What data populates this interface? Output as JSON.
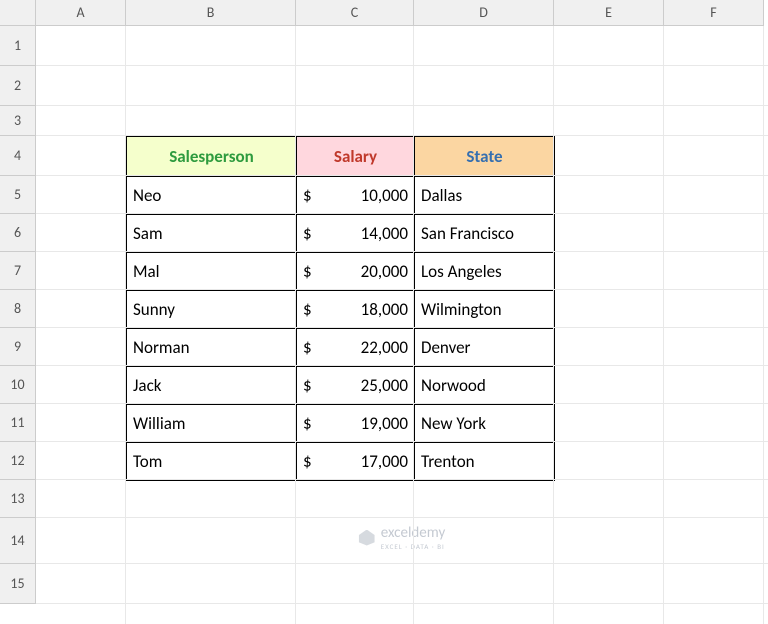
{
  "columns": [
    {
      "label": "A",
      "width": 90
    },
    {
      "label": "B",
      "width": 170
    },
    {
      "label": "C",
      "width": 118
    },
    {
      "label": "D",
      "width": 140
    },
    {
      "label": "E",
      "width": 110
    },
    {
      "label": "F",
      "width": 100
    }
  ],
  "rows": [
    {
      "label": "1",
      "height": 40
    },
    {
      "label": "2",
      "height": 40
    },
    {
      "label": "3",
      "height": 30
    },
    {
      "label": "4",
      "height": 40
    },
    {
      "label": "5",
      "height": 38
    },
    {
      "label": "6",
      "height": 38
    },
    {
      "label": "7",
      "height": 38
    },
    {
      "label": "8",
      "height": 38
    },
    {
      "label": "9",
      "height": 38
    },
    {
      "label": "10",
      "height": 38
    },
    {
      "label": "11",
      "height": 38
    },
    {
      "label": "12",
      "height": 38
    },
    {
      "label": "13",
      "height": 38
    },
    {
      "label": "14",
      "height": 46
    },
    {
      "label": "15",
      "height": 40
    }
  ],
  "table": {
    "start_col_index": 1,
    "start_row_index": 3,
    "headers": {
      "salesperson": "Salesperson",
      "salary": "Salary",
      "state": "State"
    },
    "currency_symbol": "$",
    "rows": [
      {
        "name": "Neo",
        "salary": "10,000",
        "state": "Dallas"
      },
      {
        "name": "Sam",
        "salary": "14,000",
        "state": "San Francisco"
      },
      {
        "name": "Mal",
        "salary": "20,000",
        "state": "Los Angeles"
      },
      {
        "name": "Sunny",
        "salary": "18,000",
        "state": "Wilmington"
      },
      {
        "name": "Norman",
        "salary": "22,000",
        "state": "Denver"
      },
      {
        "name": "Jack",
        "salary": "25,000",
        "state": "Norwood"
      },
      {
        "name": "William",
        "salary": "19,000",
        "state": "New York"
      },
      {
        "name": "Tom",
        "salary": "17,000",
        "state": "Trenton"
      }
    ]
  },
  "watermark": {
    "brand": "exceldemy",
    "tagline": "EXCEL · DATA · BI"
  }
}
